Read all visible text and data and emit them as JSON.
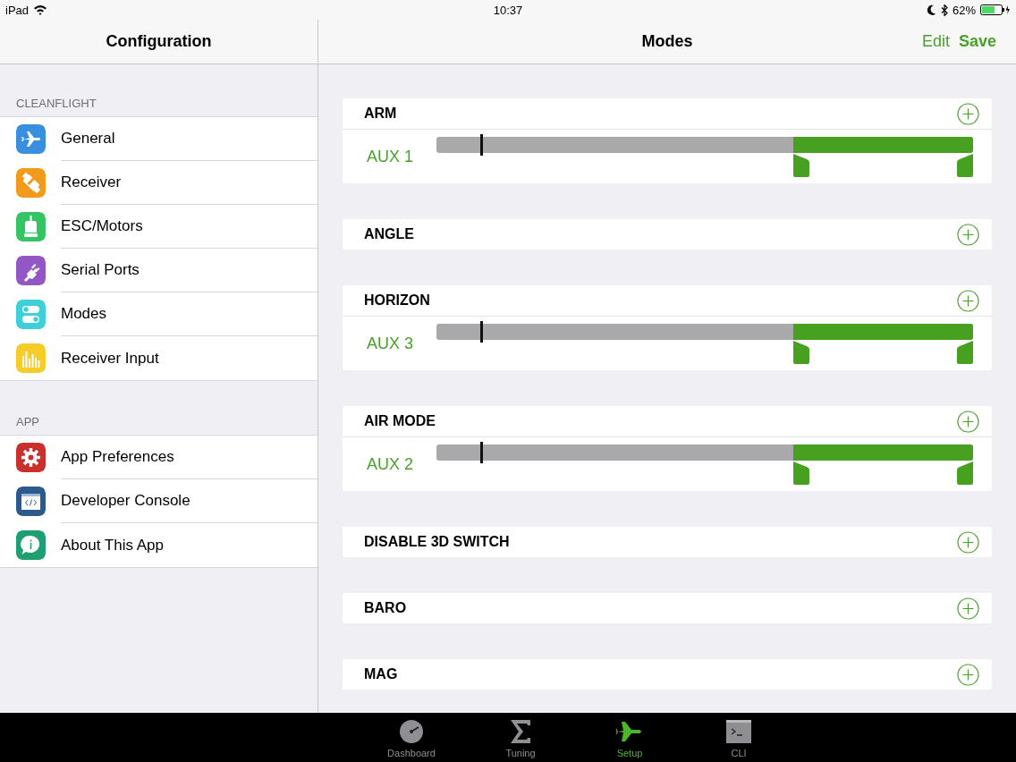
{
  "status_bar": {
    "device": "iPad",
    "time": "10:37",
    "battery": "62%"
  },
  "sidebar": {
    "title": "Configuration",
    "sections": [
      {
        "label": "CLEANFLIGHT",
        "items": [
          {
            "label": "General",
            "color": "#3a8ee0"
          },
          {
            "label": "Receiver",
            "color": "#f29a1c"
          },
          {
            "label": "ESC/Motors",
            "color": "#34c463"
          },
          {
            "label": "Serial Ports",
            "color": "#9257c4"
          },
          {
            "label": "Modes",
            "color": "#3fcfd8"
          },
          {
            "label": "Receiver Input",
            "color": "#f5cc2a"
          }
        ]
      },
      {
        "label": "APP",
        "items": [
          {
            "label": "App Preferences",
            "color": "#c9302c"
          },
          {
            "label": "Developer Console",
            "color": "#2c5a8c"
          },
          {
            "label": "About This App",
            "color": "#1f9e72"
          }
        ]
      }
    ]
  },
  "main": {
    "title": "Modes",
    "actions": [
      {
        "label": "Edit"
      },
      {
        "label": "Save"
      }
    ],
    "modes": [
      {
        "name": "ARM",
        "channel": {
          "label": "AUX 1",
          "value": {
            "level": 0.083
          },
          "range": [
            {
              "level": 0.665
            },
            {
              "level": 1
            }
          ]
        }
      },
      {
        "name": "ANGLE"
      },
      {
        "name": "HORIZON",
        "channel": {
          "label": "AUX 3",
          "value": {
            "level": 0.083
          },
          "range": [
            {
              "level": 0.665
            },
            {
              "level": 1
            }
          ]
        }
      },
      {
        "name": "AIR MODE",
        "channel": {
          "label": "AUX 2",
          "value": {
            "level": 0.083
          },
          "range": [
            {
              "level": 0.665
            },
            {
              "level": 1
            }
          ]
        }
      },
      {
        "name": "DISABLE 3D SWITCH"
      },
      {
        "name": "BARO"
      },
      {
        "name": "MAG"
      }
    ]
  },
  "tab_bar": [
    {
      "label": "Dashboard",
      "selected": false
    },
    {
      "label": "Tuning",
      "selected": false
    },
    {
      "label": "Setup",
      "selected": true
    },
    {
      "label": "CLI",
      "selected": false
    }
  ]
}
